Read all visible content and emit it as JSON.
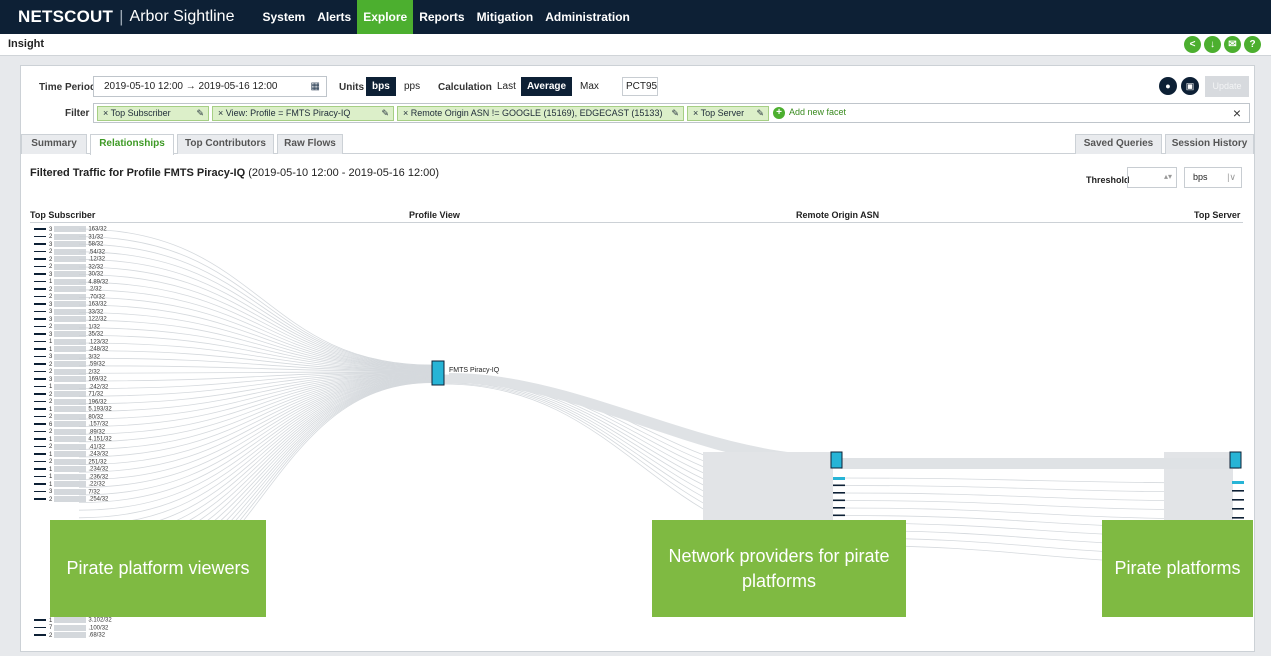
{
  "nav": {
    "brand": "NETSCOUT",
    "separator": "|",
    "product": "Arbor Sightline",
    "items": [
      "System",
      "Alerts",
      "Explore",
      "Reports",
      "Mitigation",
      "Administration"
    ],
    "active": "Explore"
  },
  "page": {
    "title": "Insight"
  },
  "controls": {
    "time_period_label": "Time Period",
    "time_period_value": "2019-05-10 12:00  →  2019-05-16 12:00",
    "units_label": "Units",
    "units": [
      "bps",
      "pps"
    ],
    "units_selected": "bps",
    "calculation_label": "Calculation",
    "calculations": [
      "Last",
      "Average",
      "Max"
    ],
    "calculation_selected": "Average",
    "percentile_value": "PCT95",
    "update_label": "Update",
    "filter_label": "Filter",
    "facets": [
      {
        "text": "×  Top Subscriber",
        "bold_prefix": ""
      },
      {
        "text": "×  View: Profile = FMTS Piracy-IQ",
        "bold_prefix": "View:"
      },
      {
        "text": "×  Remote Origin ASN != GOOGLE (15169), EDGECAST (15133)",
        "bold_prefix": ""
      },
      {
        "text": "×  Top Server",
        "bold_prefix": ""
      }
    ],
    "add_facet_label": "Add new facet"
  },
  "tabs": {
    "left": [
      "Summary",
      "Relationships",
      "Top Contributors",
      "Raw Flows"
    ],
    "active": "Relationships",
    "right": [
      "Saved Queries",
      "Session History"
    ]
  },
  "content": {
    "title": "Filtered Traffic for Profile FMTS Piracy-IQ",
    "range": "(2019-05-10 12:00 - 2019-05-16 12:00)",
    "threshold_label": "Threshold",
    "threshold_unit": "bps",
    "columns": [
      "Top Subscriber",
      "Profile View",
      "Remote Origin ASN",
      "Top Server"
    ],
    "profile_node": "FMTS Piracy-IQ",
    "subscribers": [
      {
        "n": "3",
        "ip": "163/32"
      },
      {
        "n": "2",
        "ip": "31/32"
      },
      {
        "n": "3",
        "ip": "58/32"
      },
      {
        "n": "2",
        "ip": ".54/32"
      },
      {
        "n": "2",
        "ip": ".12/32"
      },
      {
        "n": "2",
        "ip": "32/32"
      },
      {
        "n": "3",
        "ip": "30/32"
      },
      {
        "n": "1",
        "ip": "4.89/32"
      },
      {
        "n": "2",
        "ip": ".2/32"
      },
      {
        "n": "2",
        "ip": ".70/32"
      },
      {
        "n": "3",
        "ip": "163/32"
      },
      {
        "n": "3",
        "ip": "33/32"
      },
      {
        "n": "3",
        "ip": "122/32"
      },
      {
        "n": "2",
        "ip": "1/32"
      },
      {
        "n": "3",
        "ip": "35/32"
      },
      {
        "n": "1",
        "ip": ".123/32"
      },
      {
        "n": "1",
        "ip": ".248/32"
      },
      {
        "n": "3",
        "ip": "3/32"
      },
      {
        "n": "2",
        "ip": ".59/32"
      },
      {
        "n": "2",
        "ip": "2/32"
      },
      {
        "n": "3",
        "ip": "169/32"
      },
      {
        "n": "1",
        "ip": ".242/32"
      },
      {
        "n": "2",
        "ip": "71/32"
      },
      {
        "n": "2",
        "ip": "196/32"
      },
      {
        "n": "1",
        "ip": "5.193/32"
      },
      {
        "n": "2",
        "ip": "80/32"
      },
      {
        "n": "6",
        "ip": ".157/32"
      },
      {
        "n": "2",
        "ip": ".89/32"
      },
      {
        "n": "1",
        "ip": "4.151/32"
      },
      {
        "n": "2",
        "ip": ".41/32"
      },
      {
        "n": "1",
        "ip": ".243/32"
      },
      {
        "n": "2",
        "ip": "251/32"
      },
      {
        "n": "1",
        "ip": ".234/32"
      },
      {
        "n": "1",
        "ip": ".236/32"
      },
      {
        "n": "1",
        "ip": ".22/32"
      },
      {
        "n": "3",
        "ip": "7/32"
      },
      {
        "n": "2",
        "ip": ".254/32"
      }
    ],
    "subscribers_bottom": [
      {
        "n": "1",
        "ip": "3.102/32"
      },
      {
        "n": "7",
        "ip": ".100/32"
      },
      {
        "n": "2",
        "ip": ".68/32"
      }
    ]
  },
  "overlays": {
    "viewers": "Pirate platform viewers",
    "providers": "Network providers for pirate platforms",
    "platforms": "Pirate platforms"
  },
  "colors": {
    "nav_bg": "#0d2035",
    "accent_green": "#4caf2f",
    "facet_green": "#dcefc9",
    "node_cyan": "#27b4d6",
    "overlay_green": "#7fba42"
  }
}
